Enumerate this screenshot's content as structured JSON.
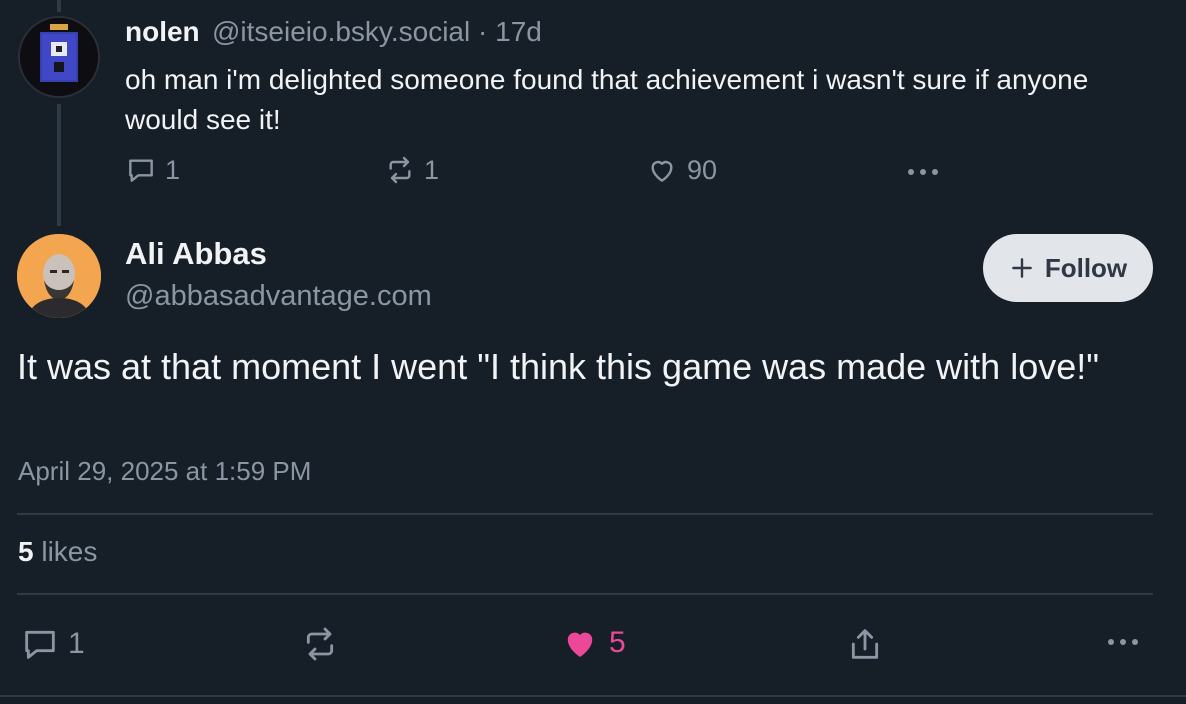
{
  "reply": {
    "author_name": "nolen",
    "handle": "@itseieio.bsky.social",
    "separator": "·",
    "age": "17d",
    "text": "oh man i'm delighted someone found that achievement i wasn't sure if anyone would see it!",
    "reply_count": "1",
    "repost_count": "1",
    "like_count": "90"
  },
  "post": {
    "author_name": "Ali Abbas",
    "handle": "@abbasadvantage.com",
    "follow_label": "Follow",
    "text": "It was at that moment I went \"I think this game was made with love!\"",
    "timestamp": "April 29, 2025 at 1:59 PM",
    "likes_count": "5",
    "likes_label": "likes",
    "reply_count": "1",
    "like_count": "5"
  },
  "colors": {
    "background": "#161e27",
    "muted": "#8a96a3",
    "like_pink": "#ec4899",
    "follow_bg": "#e2e6ea"
  }
}
